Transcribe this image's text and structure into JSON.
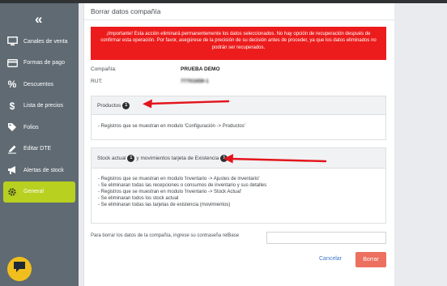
{
  "sidebar": {
    "collapse_glyph": "«",
    "items": [
      {
        "label": "Canales de venta",
        "icon": "monitor-icon"
      },
      {
        "label": "Formas de pago",
        "icon": "credit-card-icon"
      },
      {
        "label": "Descuentos",
        "icon": "percent-icon"
      },
      {
        "label": "Lista de precios",
        "icon": "dollar-icon"
      },
      {
        "label": "Folios",
        "icon": "tag-icon"
      },
      {
        "label": "Editar DTE",
        "icon": "edit-icon"
      },
      {
        "label": "Alertas de stock",
        "icon": "megaphone-icon"
      },
      {
        "label": "General",
        "icon": "gear-icon",
        "active": true
      }
    ],
    "active_color": "#b8d020",
    "chat_icon": "chat-icon"
  },
  "main": {
    "title": "Borrar datos compañía",
    "alert": "¡Importante! Esta acción eliminará permanentemente los datos seleccionados. No hay opción de recuperación después de confirmar esta operación. Por favor, asegúrese de la precisión de su decisión antes de proceder, ya que los datos eliminados no podrán ser recuperados.",
    "company_label": "Compañía:",
    "company_value": "PRUEBA DEMO",
    "rut_label": "RUT:",
    "rut_value": "77701659-1",
    "productos": {
      "title": "Productos",
      "badge": "1",
      "lines": [
        "- Registros que se muestran en modulo 'Configuración -> Productos'"
      ]
    },
    "stock": {
      "title_a": "Stock actual",
      "badge_a": "1",
      "title_b": "y movimientos tarjeta de Existencia",
      "badge_b": "1",
      "lines": [
        "- Registros que se muestran en modulo 'Inventario -> Ajustes de inventario'",
        "- Se eliminaran todas las recepciones o consumos de inventario y sus detalles",
        "- Registros que se muestran en modulo 'Inventario -> Stock Actual'",
        "- Se eliminaran todos los stock actual",
        "- Se eliminaran todas las tarjetas de existencia (movimientos)"
      ]
    },
    "password_label": "Para borrar los datos de la compañía, ingrese su contraseña relBase",
    "password_value": "",
    "cancel_label": "Cancelar",
    "delete_label": "Borrar"
  },
  "colors": {
    "alert": "#ec1c1c",
    "delete_button": "#ec6f5f",
    "cancel_link": "#3f79c6",
    "annotation_arrow": "#e3141b"
  }
}
